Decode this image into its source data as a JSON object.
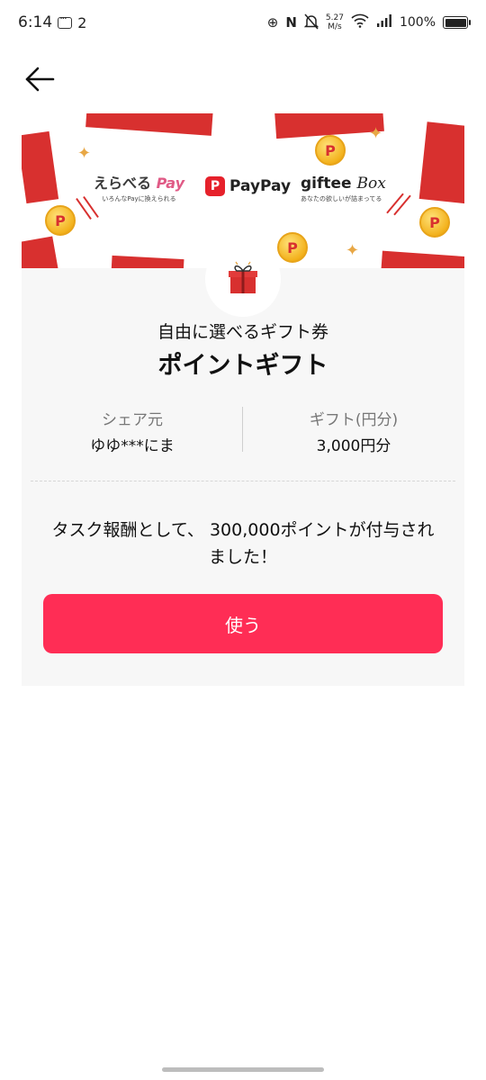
{
  "status_bar": {
    "time": "6:14",
    "notification_count": "2",
    "network_speed_value": "5.27",
    "network_speed_unit": "M/s",
    "battery": "100%"
  },
  "banner": {
    "erabel_pay_name": "えらべる",
    "erabel_pay_suffix": "Pay",
    "erabel_pay_tagline": "いろんなPayに換えられる",
    "paypay_label": "PayPay",
    "giftee_box_name": "giftee",
    "giftee_box_suffix": "Box",
    "giftee_box_tagline": "あなたの欲しいが詰まってる"
  },
  "card": {
    "subtitle": "自由に選べるギフト券",
    "title": "ポイントギフト",
    "sender_label": "シェア元",
    "sender_value": "ゆゆ***にま",
    "amount_label": "ギフト(円分)",
    "amount_value": "3,000円分",
    "message": "タスク報酬として、 300,000ポイントが付与されました！",
    "use_button_label": "使う"
  },
  "colors": {
    "accent": "#ff2d55",
    "gift_red": "#d8302f",
    "coin_gold": "#f3b21d"
  }
}
